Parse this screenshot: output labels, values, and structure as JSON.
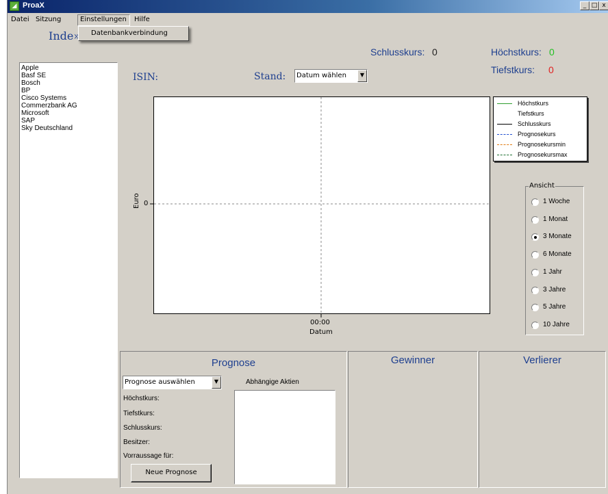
{
  "window": {
    "title": "ProaX",
    "controls": [
      "_",
      "□",
      "x"
    ]
  },
  "menu": [
    "Datei",
    "Sitzung",
    "Einstellungen",
    "Hilfe"
  ],
  "dropdown_item": "Datenbankverbindung",
  "index_label": "Inde»",
  "companies": [
    "Apple",
    "Basf SE",
    "Bosch",
    "BP",
    "Cisco Systems",
    "Commerzbank AG",
    "Microsoft",
    "SAP",
    "Sky Deutschland"
  ],
  "header": {
    "schlusskurs_label": "Schlusskurs:",
    "schlusskurs_value": "0",
    "hoechstkurs_label": "Höchstkurs:",
    "hoechstkurs_value": "0",
    "tiefstkurs_label": "Tiefstkurs:",
    "tiefstkurs_value": "0"
  },
  "isin_label": "ISIN:",
  "stand_label": "Stand:",
  "stand_select": "Datum wählen",
  "chart_data": {
    "type": "line",
    "xlabel": "Datum",
    "ylabel": "Euro",
    "x_ticks": [
      "00:00"
    ],
    "y_ticks": [
      "0"
    ],
    "series": []
  },
  "legend": [
    {
      "name": "Höchstkurs",
      "color": "#2e9e2e",
      "style": "solid"
    },
    {
      "name": "Tiefstkurs",
      "color": "#ffffff",
      "style": "solid"
    },
    {
      "name": "Schlusskurs",
      "color": "#000000",
      "style": "solid"
    },
    {
      "name": "Prognosekurs",
      "color": "#1f4fd0",
      "style": "dashdot"
    },
    {
      "name": "Prognosekursmin",
      "color": "#e07a10",
      "style": "dashed"
    },
    {
      "name": "Prognosekursmax",
      "color": "#1a6e2e",
      "style": "dashdot"
    }
  ],
  "ansicht": {
    "title": "Ansicht",
    "options": [
      "1 Woche",
      "1 Monat",
      "3 Monate",
      "6 Monate",
      "1 Jahr",
      "3 Jahre",
      "5 Jahre",
      "10 Jahre"
    ],
    "selected": "3 Monate"
  },
  "prognose": {
    "title": "Prognose",
    "select": "Prognose auswählen",
    "abhaengige_label": "Abhängige Aktien",
    "fields": [
      "Höchstkurs:",
      "Tiefstkurs:",
      "Schlusskurs:",
      "Besitzer:",
      "Vorraussage für:"
    ],
    "button": "Neue Prognose"
  },
  "gewinner_title": "Gewinner",
  "verlierer_title": "Verlierer",
  "colors": {
    "accent_blue": "#1e3f8f",
    "high_green": "#22c022",
    "low_red": "#e02020"
  }
}
